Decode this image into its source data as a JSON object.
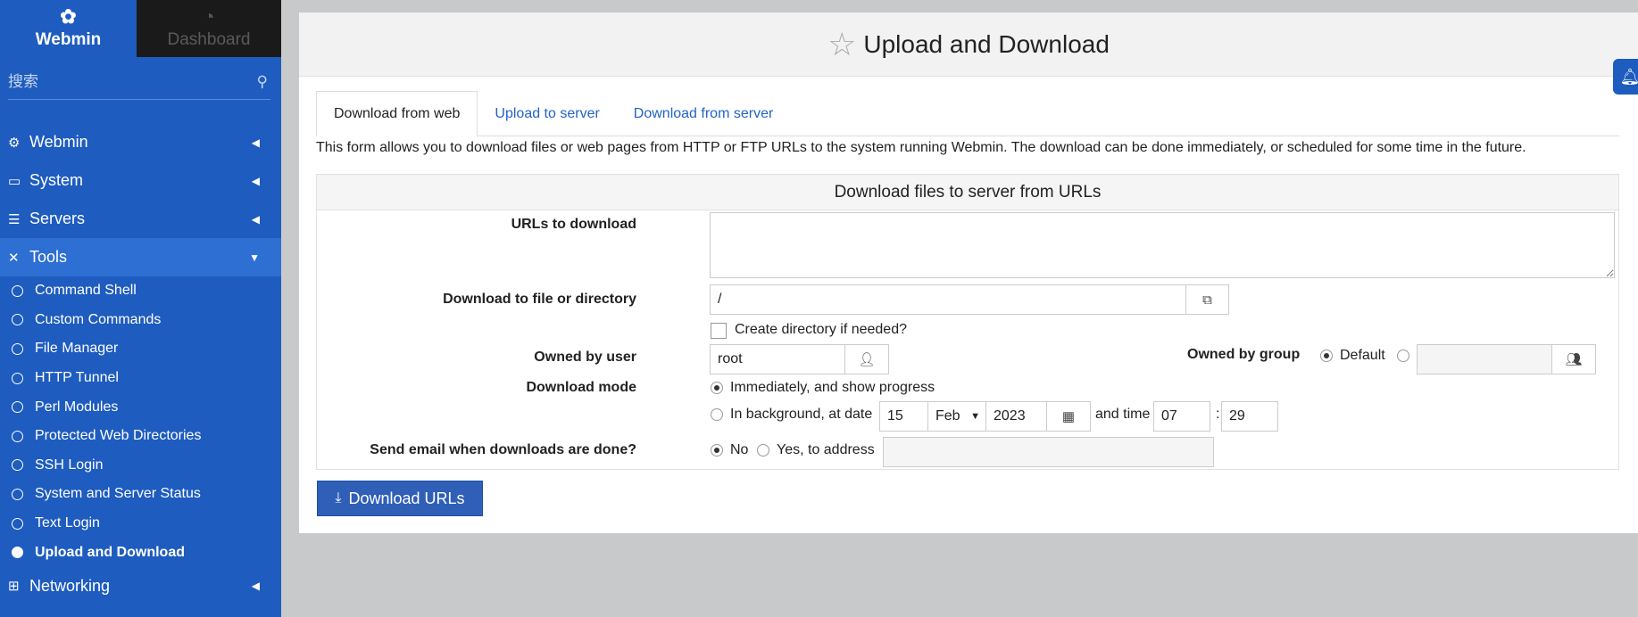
{
  "sidebar": {
    "brand_label": "Webmin",
    "dashboard_label": "Dashboard",
    "search_placeholder": "搜索",
    "menu": [
      {
        "label": "Webmin"
      },
      {
        "label": "System"
      },
      {
        "label": "Servers"
      },
      {
        "label": "Tools"
      },
      {
        "label": "Networking"
      }
    ],
    "tools_items": [
      "Command Shell",
      "Custom Commands",
      "File Manager",
      "HTTP Tunnel",
      "Perl Modules",
      "Protected Web Directories",
      "SSH Login",
      "System and Server Status",
      "Text Login",
      "Upload and Download"
    ]
  },
  "page": {
    "title": "Upload and Download",
    "tabs": [
      "Download from web",
      "Upload to server",
      "Download from server"
    ],
    "description": "This form allows you to download files or web pages from HTTP or FTP URLs to the system running Webmin. The download can be done immediately, or scheduled for some time in the future."
  },
  "form": {
    "section_title": "Download files to server from URLs",
    "urls_label": "URLs to download",
    "urls_value": "",
    "dest_label": "Download to file or directory",
    "dest_value": "/",
    "create_dir_label": "Create directory if needed?",
    "owner_label": "Owned by user",
    "owner_value": "root",
    "group_label": "Owned by group",
    "group_default_label": "Default",
    "group_value": "",
    "mode_label": "Download mode",
    "mode_immediate_label": "Immediately, and show progress",
    "mode_background_label": "In background, at date",
    "date_day": "15",
    "date_month": "Feb",
    "date_year": "2023",
    "and_time_label": "and time",
    "time_hour": "07",
    "time_sep": ":",
    "time_minute": "29",
    "email_label": "Send email when downloads are done?",
    "email_no_label": "No",
    "email_yes_label": "Yes, to address",
    "email_value": "",
    "submit_label": "Download URLs"
  }
}
